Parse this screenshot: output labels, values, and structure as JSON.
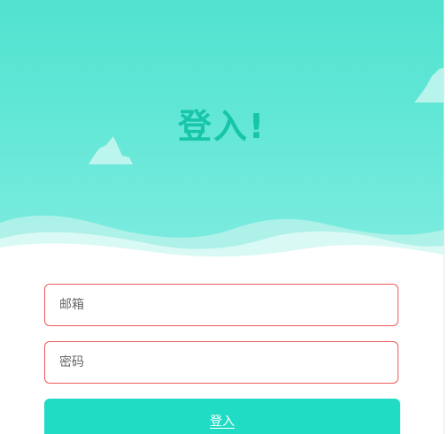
{
  "login": {
    "title": "登入!",
    "email_placeholder": "邮箱",
    "password_placeholder": "密码",
    "submit_label": "登入"
  },
  "colors": {
    "hero_top": "#52e2cf",
    "title": "#17c5a8",
    "field_border": "#ef5a5a",
    "button": "#20dcc4"
  },
  "icons": [
    "cloud-icon",
    "cloud-icon"
  ]
}
